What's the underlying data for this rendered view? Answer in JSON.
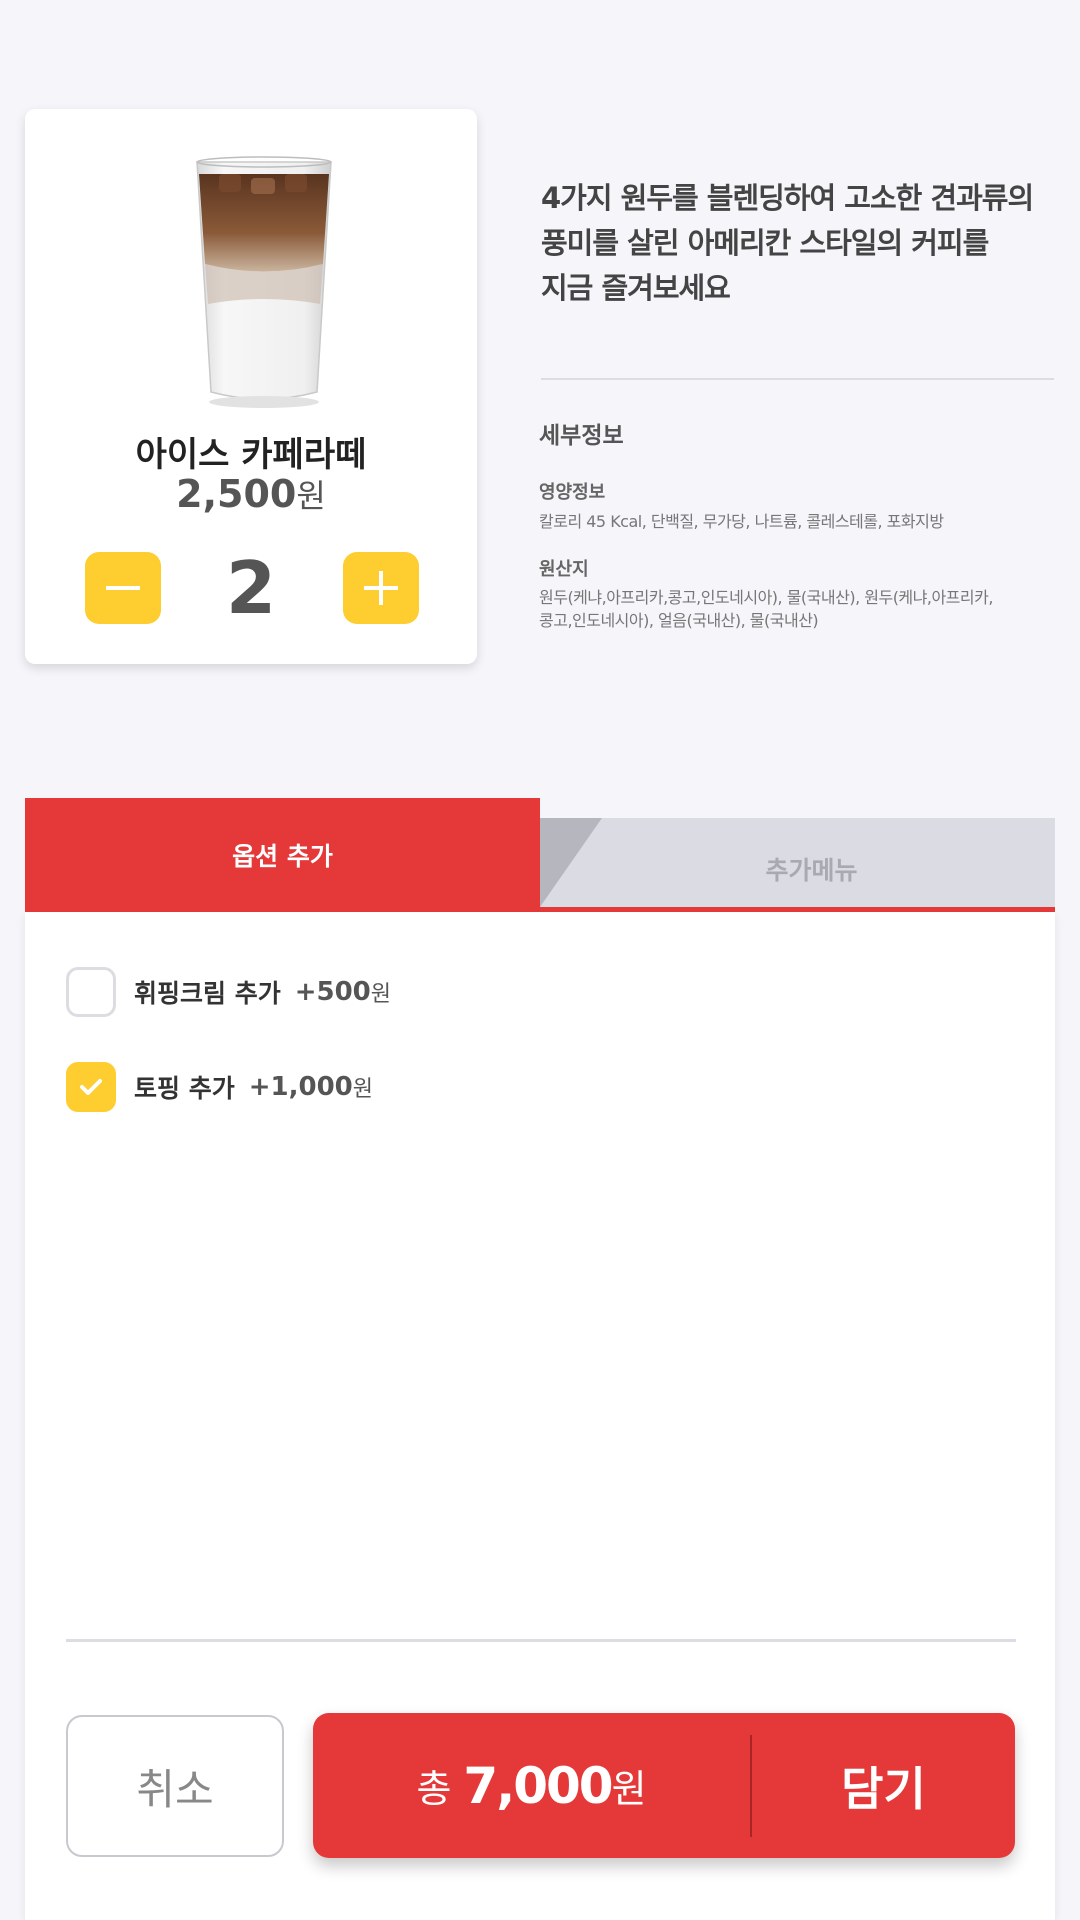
{
  "product": {
    "name": "아이스 카페라떼",
    "price": "2,500",
    "price_unit": "원",
    "quantity": "2",
    "image_icon": "iced-latte-image"
  },
  "description": {
    "lines": [
      "4가지 원두를 블렌딩하여 고소한 견과류의",
      "풍미를 살린 아메리칸 스타일의 커피를",
      "지금 즐겨보세요"
    ]
  },
  "details": {
    "title": "세부정보",
    "nutrition_label": "영양정보",
    "nutrition_text": "칼로리 45 Kcal, 단백질, 무가당, 나트륨, 콜레스테롤, 포화지방",
    "origin_label": "원산지",
    "origin_text_1": "원두(케냐,아프리카,콩고,인도네시아), 물(국내산),  원두(케냐,아프리카,",
    "origin_text_2": "콩고,인도네시아), 얼음(국내산), 물(국내산)"
  },
  "tabs": {
    "active": "옵션 추가",
    "inactive": "추가메뉴"
  },
  "options": [
    {
      "label": "휘핑크림 추가",
      "price": "+500",
      "unit": "원",
      "checked": false
    },
    {
      "label": "토핑 추가",
      "price": "+1,000",
      "unit": "원",
      "checked": true
    }
  ],
  "actions": {
    "cancel": "취소",
    "total_label": "총",
    "total_amount": "7,000",
    "total_unit": "원",
    "add": "담기"
  },
  "colors": {
    "accent_red": "#e53939",
    "accent_yellow": "#fecd2f",
    "background": "#f5f5fa"
  }
}
